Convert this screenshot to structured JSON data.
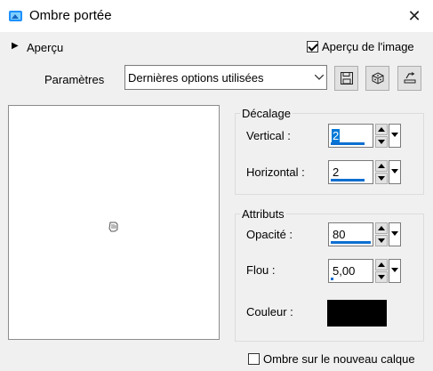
{
  "window": {
    "title": "Ombre portée"
  },
  "preview": {
    "toggle_label": "Aperçu"
  },
  "image_preview": {
    "label": "Aperçu de l'image",
    "checked": true
  },
  "params": {
    "label": "Paramètres",
    "preset_value": "Dernières options utilisées"
  },
  "offset": {
    "group_title": "Décalage",
    "vertical_label": "Vertical :",
    "vertical_value": "2",
    "horizontal_label": "Horizontal :",
    "horizontal_value": "2"
  },
  "attributes": {
    "group_title": "Attributs",
    "opacity_label": "Opacité :",
    "opacity_value": "80",
    "blur_label": "Flou :",
    "blur_value": "5,00",
    "color_label": "Couleur :",
    "color_value": "#000000"
  },
  "new_layer": {
    "label": "Ombre sur le nouveau calque",
    "checked": false
  },
  "icons": {
    "app": "app-icon",
    "close": "close-icon",
    "toggle": "triangle-right-icon",
    "save": "floppy-disk-icon",
    "reset": "dice-icon",
    "manage": "preset-manager-icon",
    "cursor": "move-cursor-icon"
  },
  "colors": {
    "accent": "#0d6fd1",
    "window_bg": "#f0f0f0",
    "selection": "#0078d7"
  }
}
